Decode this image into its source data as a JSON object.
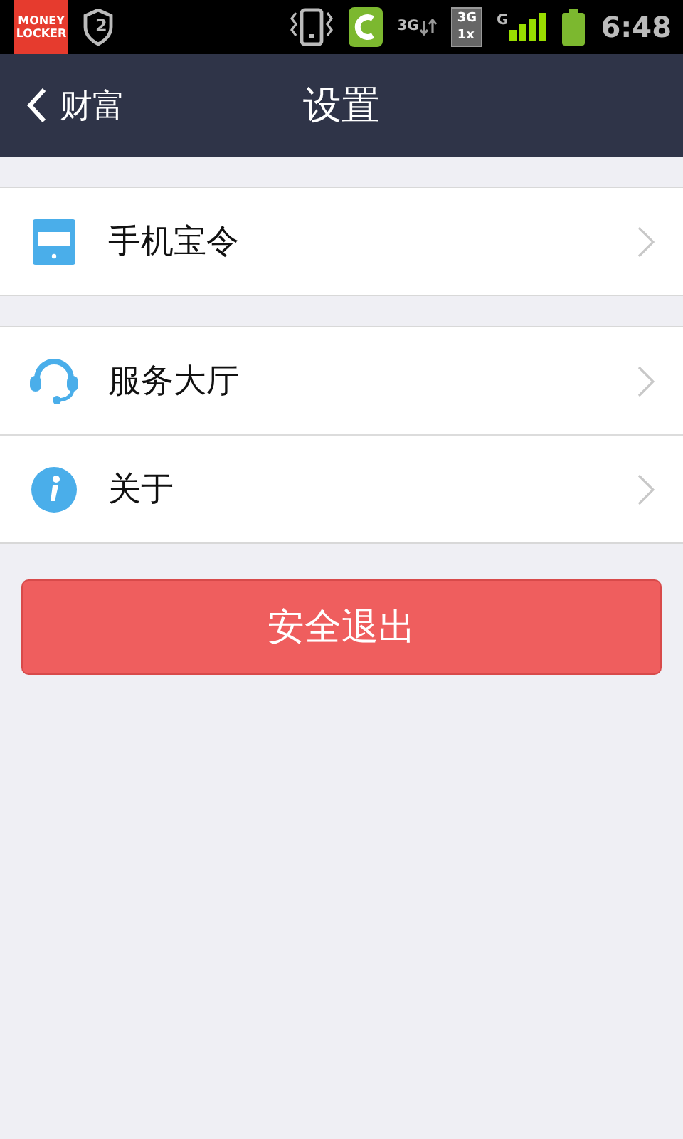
{
  "status_bar": {
    "app_badge": "MONEY LOCKER",
    "shield_count": "2",
    "data_label": "3G",
    "dual_top": "3G",
    "dual_bottom": "1x",
    "signal_label": "G",
    "time": "6:48"
  },
  "nav": {
    "back": "财富",
    "title": "设置"
  },
  "sections": [
    {
      "items": [
        {
          "kind": "token",
          "label": "手机宝令"
        }
      ]
    },
    {
      "items": [
        {
          "kind": "headset",
          "label": "服务大厅"
        },
        {
          "kind": "info",
          "label": "关于"
        }
      ]
    }
  ],
  "logout_button": "安全退出"
}
